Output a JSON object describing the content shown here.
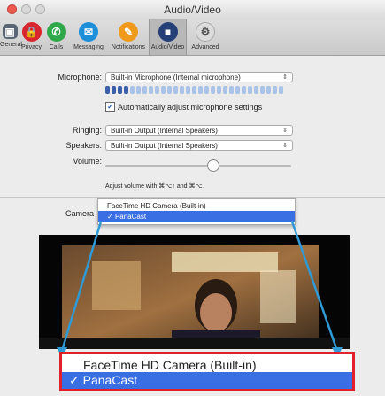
{
  "window": {
    "title": "Audio/Video"
  },
  "toolbar": {
    "items": [
      {
        "label": "General",
        "icon": "general-icon",
        "color": "#5a6675"
      },
      {
        "label": "Privacy",
        "icon": "lock-icon",
        "color": "#d9262e"
      },
      {
        "label": "Calls",
        "icon": "phone-icon",
        "color": "#2fa84b"
      },
      {
        "label": "Messaging",
        "icon": "message-icon",
        "color": "#1d8fd8"
      },
      {
        "label": "Notifications",
        "icon": "bell-icon",
        "color": "#f09a1c"
      },
      {
        "label": "Audio/Video",
        "icon": "video-icon",
        "color": "#243f78"
      },
      {
        "label": "Advanced",
        "icon": "gear-icon",
        "color": "#dcdcdc"
      }
    ]
  },
  "settings": {
    "microphone_label": "Microphone:",
    "microphone_value": "Built-in Microphone (Internal microphone)",
    "auto_adjust_label": "Automatically adjust microphone settings",
    "auto_adjust_checked": true,
    "ringing_label": "Ringing:",
    "ringing_value": "Built-in Output (Internal Speakers)",
    "speakers_label": "Speakers:",
    "speakers_value": "Built-in Output (Internal Speakers)",
    "volume_label": "Volume:",
    "volume_level": 0.58,
    "volume_hint": "Adjust volume with ⌘⌥↑ and ⌘⌥↓",
    "camera_label": "Camera"
  },
  "camera_menu": {
    "options": [
      "FaceTime HD Camera (Built-in)",
      "PanaCast"
    ],
    "selected": "PanaCast",
    "check_mark": "✓"
  },
  "colors": {
    "selection": "#3a6fe3",
    "highlight_border": "#e0202a",
    "callout_arrow": "#2f9ad6",
    "meter_active": "#3a5fa8",
    "meter_inactive": "#a9c2e8"
  }
}
